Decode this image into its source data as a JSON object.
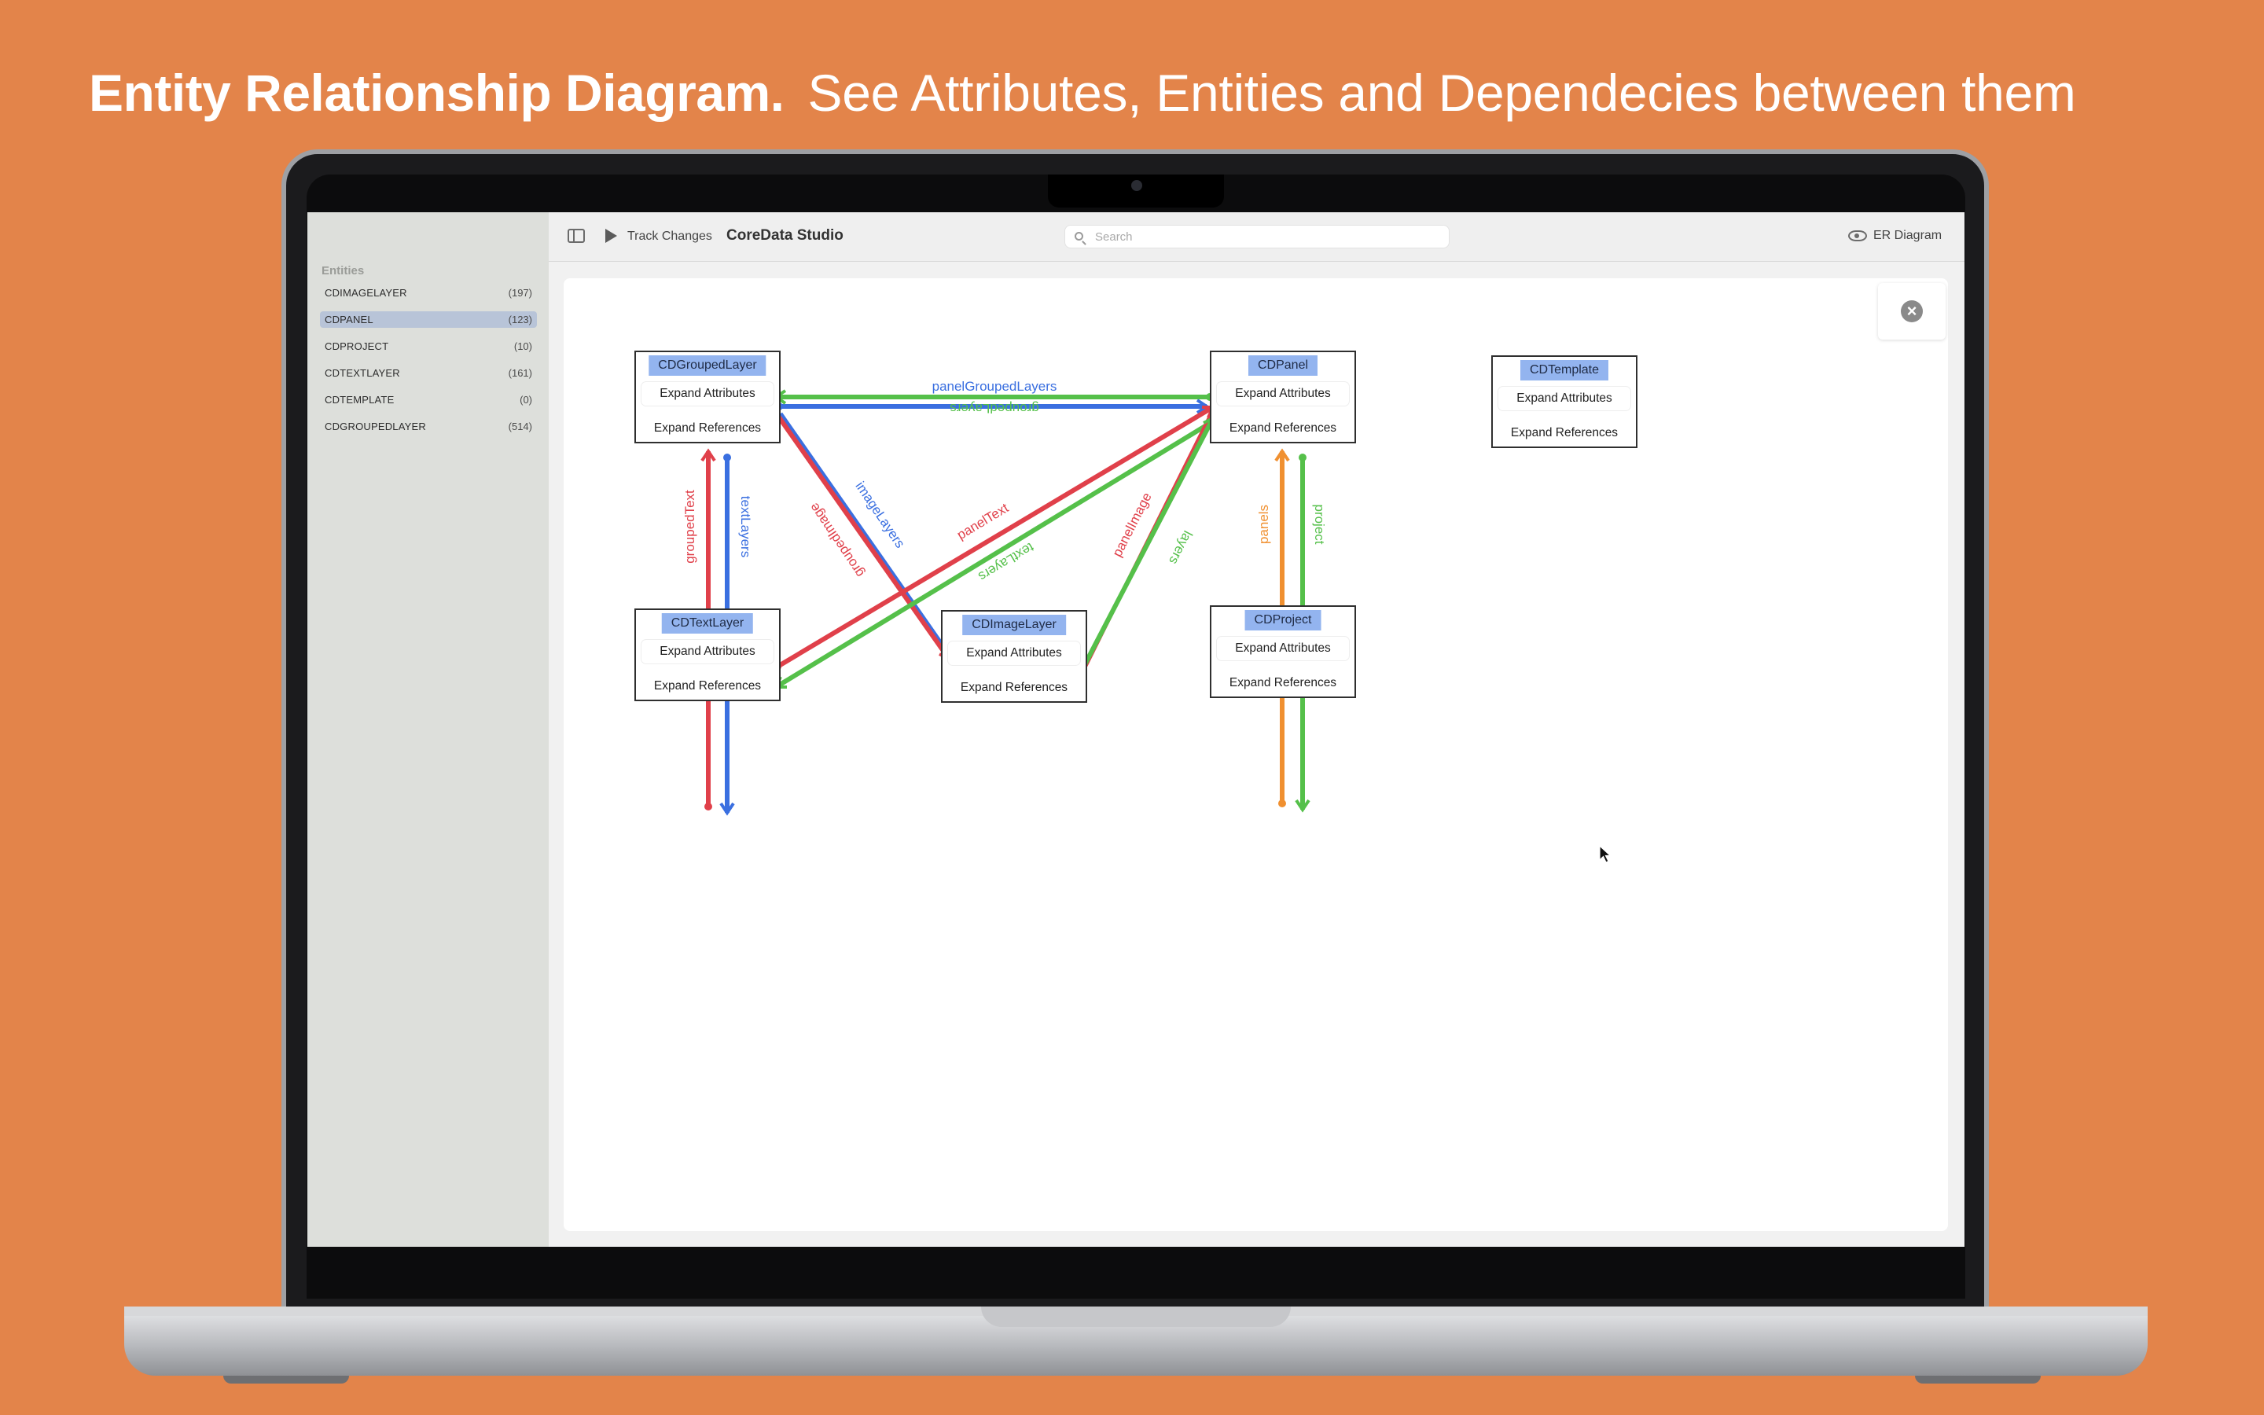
{
  "headline": {
    "bold": "Entity Relationship Diagram.",
    "light": "See Attributes, Entities and Dependecies between them"
  },
  "sidebar": {
    "heading": "Entities",
    "items": [
      {
        "name": "CDIMAGELAYER",
        "count": "(197)",
        "selected": false
      },
      {
        "name": "CDPANEL",
        "count": "(123)",
        "selected": true
      },
      {
        "name": "CDPROJECT",
        "count": "(10)",
        "selected": false
      },
      {
        "name": "CDTEXTLAYER",
        "count": "(161)",
        "selected": false
      },
      {
        "name": "CDTEMPLATE",
        "count": "(0)",
        "selected": false
      },
      {
        "name": "CDGROUPEDLAYER",
        "count": "(514)",
        "selected": false
      }
    ]
  },
  "toolbar": {
    "track_label": "Track Changes",
    "app_title": "CoreData Studio",
    "search_placeholder": "Search",
    "view_label": "ER Diagram",
    "icons": [
      "sidebar-toggle-icon",
      "play-icon",
      "search-icon",
      "eye-icon"
    ]
  },
  "canvas": {
    "close_icon": "×",
    "entities": [
      {
        "name": "CDGroupedLayer",
        "attributes_label": "Expand Attributes",
        "references_label": "Expand References"
      },
      {
        "name": "CDPanel",
        "attributes_label": "Expand Attributes",
        "references_label": "Expand References"
      },
      {
        "name": "CDTemplate",
        "attributes_label": "Expand Attributes",
        "references_label": "Expand References"
      },
      {
        "name": "CDTextLayer",
        "attributes_label": "Expand Attributes",
        "references_label": "Expand References"
      },
      {
        "name": "CDImageLayer",
        "attributes_label": "Expand Attributes",
        "references_label": "Expand References"
      },
      {
        "name": "CDProject",
        "attributes_label": "Expand Attributes",
        "references_label": "Expand References"
      }
    ],
    "relationships": [
      {
        "label": "panelGroupedLayers",
        "color": "#3a6fe0"
      },
      {
        "label": "groupedLayers",
        "color": "#55c04a"
      },
      {
        "label": "groupedText",
        "color": "#e0404a"
      },
      {
        "label": "textLayers",
        "color": "#3a6fe0"
      },
      {
        "label": "imageLayers",
        "color": "#3a6fe0"
      },
      {
        "label": "groupedImage",
        "color": "#e0404a"
      },
      {
        "label": "panelText",
        "color": "#e0404a"
      },
      {
        "label": "textLayers",
        "color": "#55c04a"
      },
      {
        "label": "panelImage",
        "color": "#e0404a"
      },
      {
        "label": "layers",
        "color": "#55c04a"
      },
      {
        "label": "panels",
        "color": "#f09030"
      },
      {
        "label": "project",
        "color": "#55c04a"
      }
    ]
  },
  "colors": {
    "background": "#E3844A",
    "entity_title": "#93b4ef",
    "selection": "#b8c4d8",
    "red": "#e0404a",
    "green": "#55c04a",
    "blue": "#3a6fe0",
    "orange": "#f09030"
  }
}
